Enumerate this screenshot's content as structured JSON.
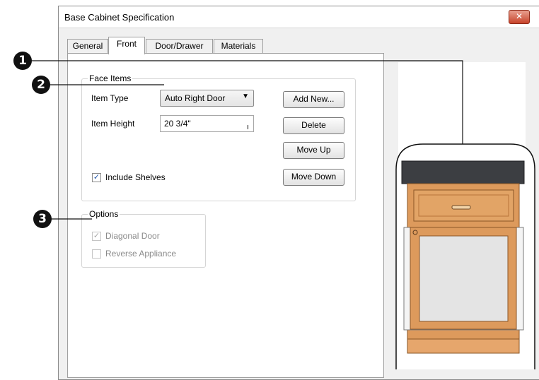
{
  "window": {
    "title": "Base Cabinet Specification",
    "close_label": "✕"
  },
  "tabs": [
    {
      "label": "General",
      "active": false
    },
    {
      "label": "Front",
      "active": true
    },
    {
      "label": "Door/Drawer",
      "active": false
    },
    {
      "label": "Materials",
      "active": false
    }
  ],
  "face_items": {
    "legend": "Face Items",
    "item_type_label": "Item Type",
    "item_type_value": "Auto Right Door",
    "item_height_label": "Item Height",
    "item_height_value": "20 3/4\"",
    "include_shelves_label": "Include Shelves",
    "include_shelves_checked": true,
    "buttons": {
      "add_new": "Add New...",
      "delete": "Delete",
      "move_up": "Move Up",
      "move_down": "Move Down"
    }
  },
  "options": {
    "legend": "Options",
    "diagonal_door_label": "Diagonal Door",
    "diagonal_door_checked": true,
    "diagonal_door_enabled": false,
    "reverse_appliance_label": "Reverse Appliance",
    "reverse_appliance_checked": false,
    "reverse_appliance_enabled": false
  },
  "callouts": [
    "1",
    "2",
    "3"
  ],
  "colors": {
    "cabinet_wood": "#dd9a5c",
    "cabinet_wood_dark": "#b8743a",
    "countertop": "#3c3e42",
    "door_panel": "#e4e4e4",
    "close_button": "#c8432a"
  }
}
